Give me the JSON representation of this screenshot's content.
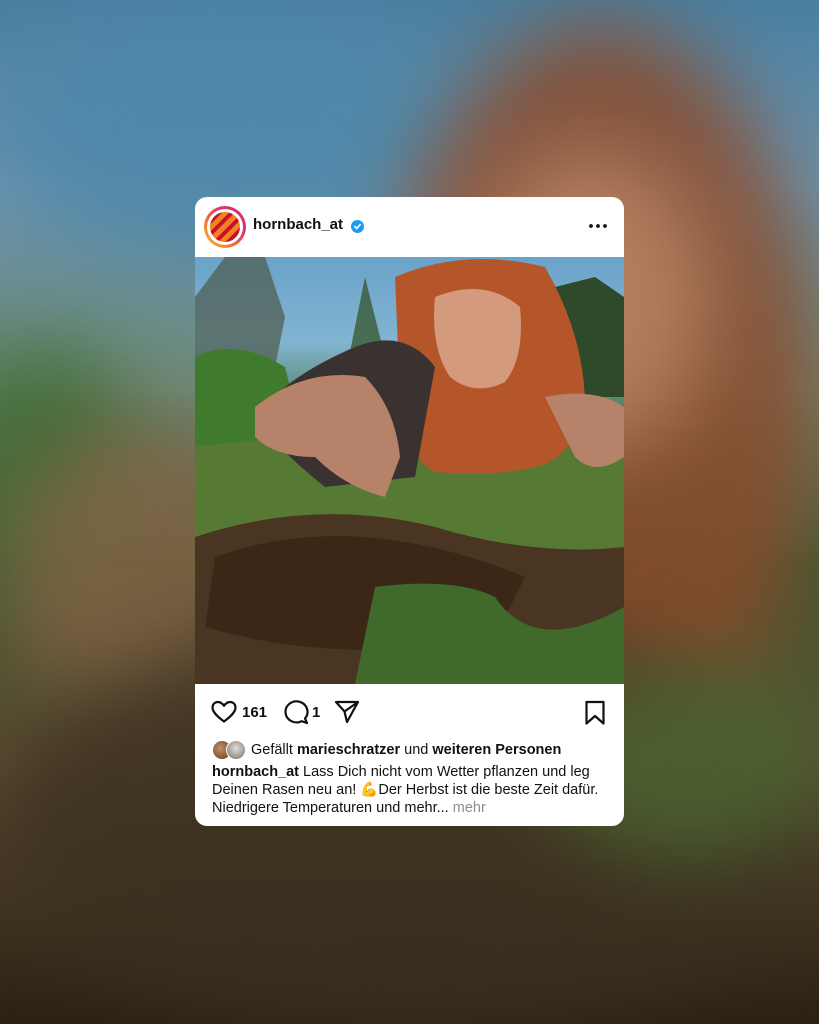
{
  "post": {
    "username": "hornbach_at",
    "verified": true,
    "like_count": "161",
    "comment_count": "1",
    "likes_prefix": "Gefällt",
    "liked_by_user": "marieschratzer",
    "likes_and": "und",
    "likes_others": "weiteren Personen",
    "caption_user": "hornbach_at",
    "caption_text": "Lass Dich nicht vom Wetter pflanzen und leg Deinen Rasen neu an! 💪Der Herbst ist die beste Zeit dafür. Niedrigere Temperaturen und mehr...",
    "caption_more": "mehr"
  },
  "icons": {
    "avatar": "hornbach-logo-avatar",
    "verified": "verified-badge-icon",
    "more": "more-options-icon",
    "like": "heart-icon",
    "comment": "comment-bubble-icon",
    "share": "paper-plane-icon",
    "save": "bookmark-icon"
  },
  "colors": {
    "verified": "#1d9bf0",
    "text": "#111111",
    "muted": "#8e8e8e"
  }
}
